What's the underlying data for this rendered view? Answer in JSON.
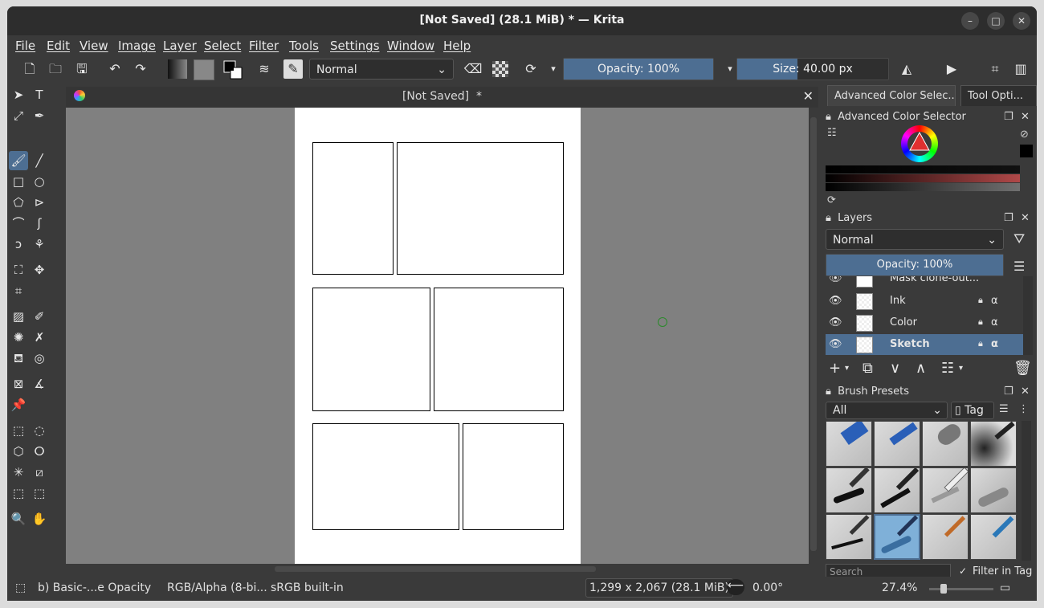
{
  "window": {
    "title": "[Not Saved]  (28.1 MiB)  * — Krita",
    "minimize": "–",
    "maximize": "□",
    "close": "✕"
  },
  "menu": [
    "File",
    "Edit",
    "View",
    "Image",
    "Layer",
    "Select",
    "Filter",
    "Tools",
    "Settings",
    "Window",
    "Help"
  ],
  "toolbar": {
    "blend_mode": "Normal",
    "opacity_label": "Opacity: 100%",
    "opacity_value": 1.0,
    "size_label": "Size: 40.00 px",
    "size_fill": 0.4
  },
  "document": {
    "tab_title": "[Not Saved]  *",
    "close": "✕"
  },
  "right_panel": {
    "tabs": [
      "Advanced Color Selec...",
      "Tool Opti..."
    ],
    "color_selector_title": "Advanced Color Selector",
    "layers_title": "Layers",
    "layers_blend": "Normal",
    "layers_opacity": "Opacity:  100%",
    "layers": [
      {
        "name": "Mask clone-out..."
      },
      {
        "name": "Ink"
      },
      {
        "name": "Color"
      },
      {
        "name": "Sketch",
        "selected": true
      }
    ],
    "brush_presets_title": "Brush Presets",
    "brush_filter": "All",
    "tag_label": "Tag",
    "search_placeholder": "Search",
    "filter_in_tag": "Filter in Tag"
  },
  "status": {
    "brush": "b) Basic-...e Opacity",
    "color_model": "RGB/Alpha (8-bi...",
    "profile": "sRGB built-in",
    "dimensions": "1,299 x 2,067 (28.1 MiB)",
    "rotation": "0.00°",
    "zoom": "27.4%"
  },
  "colors": {
    "accent": "#4d6e92",
    "canvas_bg": "#808080",
    "ui_bg": "#3a3a3a"
  }
}
